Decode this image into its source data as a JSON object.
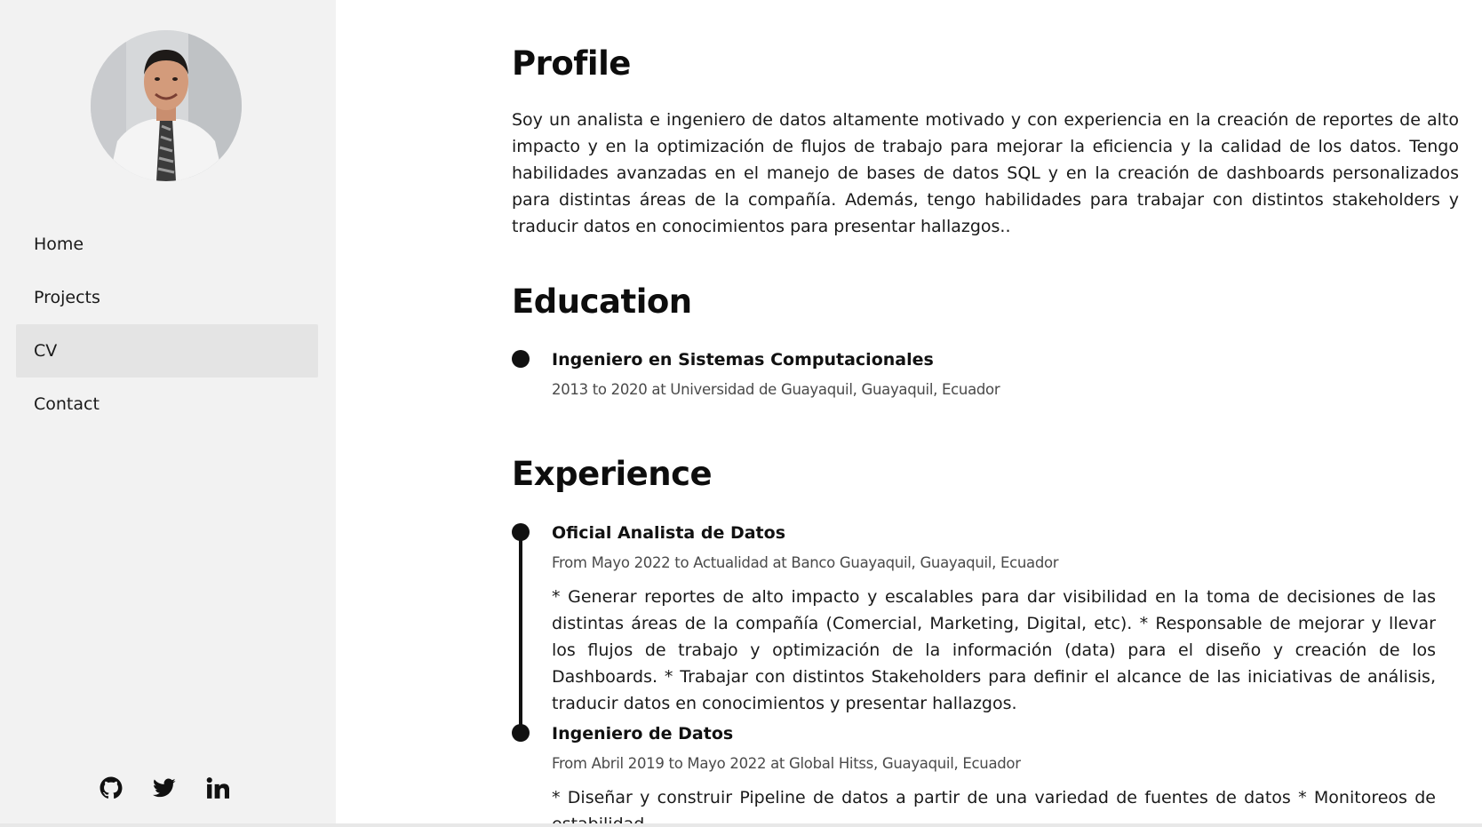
{
  "sidebar": {
    "nav": [
      {
        "label": "Home",
        "active": false
      },
      {
        "label": "Projects",
        "active": false
      },
      {
        "label": "CV",
        "active": true
      },
      {
        "label": "Contact",
        "active": false
      }
    ],
    "social": [
      "github-icon",
      "twitter-icon",
      "linkedin-icon"
    ]
  },
  "profile": {
    "title": "Profile",
    "text": "Soy un analista e ingeniero de datos altamente motivado y con experiencia en la creación de reportes de alto impacto y en la optimización de flujos de trabajo para mejorar la eficiencia y la calidad de los datos. Tengo habilidades avanzadas en el manejo de bases de datos SQL y en la creación de dashboards personalizados para distintas áreas de la compañía. Además, tengo habilidades para trabajar con distintos stakeholders y traducir datos en conocimientos para presentar hallazgos.."
  },
  "education": {
    "title": "Education",
    "items": [
      {
        "title": "Ingeniero en Sistemas Computacionales",
        "subtitle": "2013 to 2020 at Universidad de Guayaquil, Guayaquil, Ecuador"
      }
    ]
  },
  "experience": {
    "title": "Experience",
    "items": [
      {
        "title": "Oficial Analista de Datos",
        "subtitle": "From Mayo 2022 to Actualidad at Banco Guayaquil, Guayaquil, Ecuador",
        "description": "* Generar reportes de alto impacto y escalables para dar visibilidad en la toma de decisiones de las distintas áreas de la compañía (Comercial, Marketing, Digital, etc). * Responsable de mejorar y llevar los flujos de trabajo y optimización de la información (data) para el diseño y creación de los Dashboards. * Trabajar con distintos Stakeholders para definir el alcance de las iniciativas de análisis, traducir datos en conocimientos y presentar hallazgos."
      },
      {
        "title": "Ingeniero de Datos",
        "subtitle": "From Abril 2019 to Mayo 2022 at Global Hitss, Guayaquil, Ecuador",
        "description": "* Diseñar y construir Pipeline de datos a partir de una variedad de fuentes de datos * Monitoreos de estabilidad"
      }
    ]
  }
}
